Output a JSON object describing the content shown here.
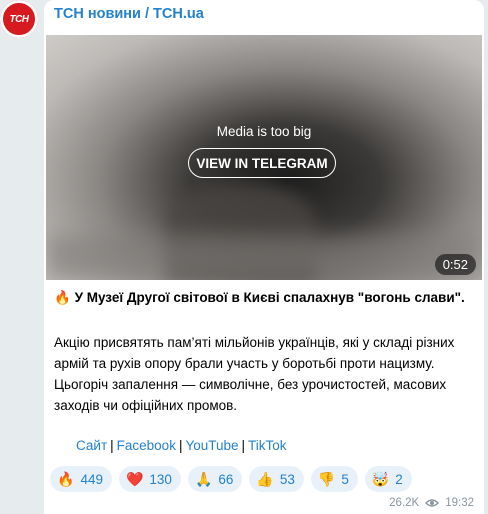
{
  "channel": {
    "avatar_text": "TCH",
    "name": "ТСН новини / TCH.ua"
  },
  "media": {
    "notice": "Media is too big",
    "view_button": "VIEW IN TELEGRAM",
    "duration": "0:52"
  },
  "post": {
    "headline_emoji": "🔥",
    "headline": "У Музеї Другої світової в Києві спалахнув \"вогонь слави\".",
    "body": "Акцію присвятять пам’яті мільйонів українців, які у складі різних армій та рухів опору брали участь у боротьбі проти нацизму. Цьогоріч запалення — символічне, без урочистостей, масових заходів чи офіційних промов.",
    "links": [
      "Сайт",
      "Facebook",
      "YouTube",
      "TikTok"
    ],
    "link_separator": "|"
  },
  "reactions": [
    {
      "emoji": "🔥",
      "count": "449",
      "icon": "fire-icon"
    },
    {
      "emoji": "❤️",
      "count": "130",
      "icon": "heart-icon"
    },
    {
      "emoji": "🙏",
      "count": "66",
      "icon": "pray-icon"
    },
    {
      "emoji": "👍",
      "count": "53",
      "icon": "thumbs-up-icon"
    },
    {
      "emoji": "👎",
      "count": "5",
      "icon": "thumbs-down-icon"
    },
    {
      "emoji": "🤯",
      "count": "2",
      "icon": "exploding-head-icon"
    }
  ],
  "meta": {
    "views": "26.2K",
    "time": "19:32"
  },
  "colors": {
    "accent": "#2481cc",
    "background": "#e6ebee",
    "reaction_bg": "#e8f1fa"
  }
}
